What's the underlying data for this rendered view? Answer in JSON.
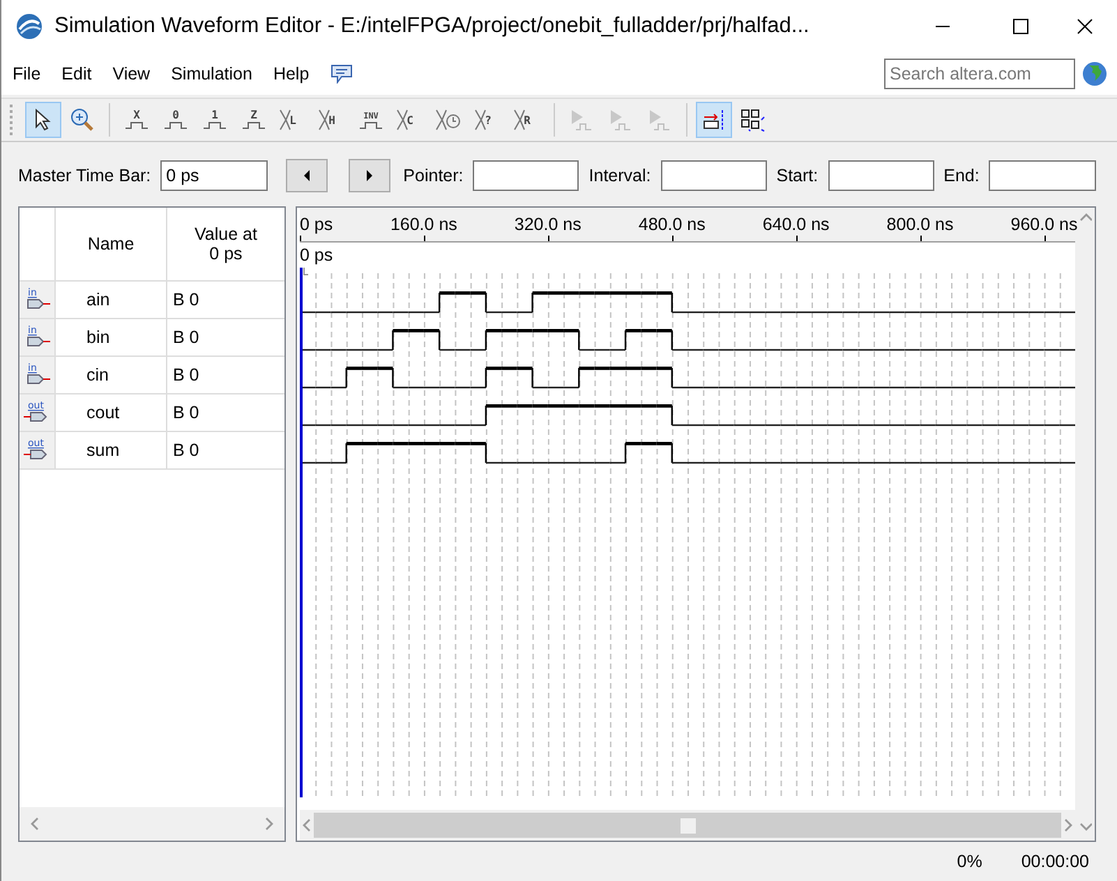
{
  "window": {
    "title": "Simulation Waveform Editor - E:/intelFPGA/project/onebit_fulladder/prj/halfad..."
  },
  "menu": [
    "File",
    "Edit",
    "View",
    "Simulation",
    "Help"
  ],
  "search": {
    "placeholder": "Search altera.com"
  },
  "toolbar": [
    {
      "kind": "pointer",
      "selected": true,
      "disabled": false
    },
    {
      "kind": "zoom",
      "selected": false,
      "disabled": false
    },
    {
      "kind": "separator"
    },
    {
      "kind": "level",
      "glyph": "X",
      "selected": false,
      "disabled": false
    },
    {
      "kind": "level",
      "glyph": "0",
      "selected": false,
      "disabled": false
    },
    {
      "kind": "level",
      "glyph": "1",
      "selected": false,
      "disabled": false
    },
    {
      "kind": "level",
      "glyph": "Z",
      "selected": false,
      "disabled": false
    },
    {
      "kind": "bus",
      "glyph": "L",
      "selected": false,
      "disabled": false
    },
    {
      "kind": "bus",
      "glyph": "H",
      "selected": false,
      "disabled": false
    },
    {
      "kind": "level",
      "glyph": "INV",
      "selected": false,
      "disabled": false
    },
    {
      "kind": "bus",
      "glyph": "C",
      "selected": false,
      "disabled": false
    },
    {
      "kind": "clock",
      "selected": false,
      "disabled": false
    },
    {
      "kind": "bus",
      "glyph": "?",
      "selected": false,
      "disabled": false
    },
    {
      "kind": "bus",
      "glyph": "R",
      "selected": false,
      "disabled": false
    },
    {
      "kind": "separator"
    },
    {
      "kind": "run",
      "selected": false,
      "disabled": true
    },
    {
      "kind": "run",
      "selected": false,
      "disabled": true
    },
    {
      "kind": "run",
      "selected": false,
      "disabled": true
    },
    {
      "kind": "separator"
    },
    {
      "kind": "snap",
      "selected": true,
      "disabled": false
    },
    {
      "kind": "grid",
      "selected": false,
      "disabled": false
    }
  ],
  "time_bar": {
    "master_label": "Master Time Bar:",
    "master_value": "0 ps",
    "pointer_label": "Pointer:",
    "interval_label": "Interval:",
    "start_label": "Start:",
    "end_label": "End:"
  },
  "table": {
    "columns": [
      "Name",
      "Value at\n0 ps"
    ],
    "rows": [
      {
        "direction": "in",
        "name": "ain",
        "value": "B 0",
        "steps": [
          {
            "high": false
          },
          {
            "high": false
          },
          {
            "high": false
          },
          {
            "high": false
          },
          {
            "high": false
          },
          {
            "high": false
          },
          {
            "high": false
          },
          {
            "high": false
          },
          {
            "high": false
          },
          {
            "high": true
          },
          {
            "high": true
          },
          {
            "high": true
          },
          {
            "high": false
          },
          {
            "high": false
          },
          {
            "high": false
          },
          {
            "high": true
          },
          {
            "high": true
          },
          {
            "high": true
          },
          {
            "high": true
          },
          {
            "high": true
          },
          {
            "high": true
          },
          {
            "high": true
          },
          {
            "high": true
          },
          {
            "high": true
          },
          {
            "high": false
          },
          {
            "high": false
          },
          {
            "high": false
          },
          {
            "high": false
          },
          {
            "high": false
          },
          {
            "high": false
          },
          {
            "high": false
          },
          {
            "high": false
          },
          {
            "high": false
          },
          {
            "high": false
          },
          {
            "high": false
          },
          {
            "high": false
          },
          {
            "high": false
          },
          {
            "high": false
          },
          {
            "high": false
          },
          {
            "high": false
          },
          {
            "high": false
          },
          {
            "high": false
          },
          {
            "high": false
          },
          {
            "high": false
          },
          {
            "high": false
          },
          {
            "high": false
          },
          {
            "high": false
          },
          {
            "high": false
          },
          {
            "high": false
          },
          {
            "high": false
          }
        ]
      },
      {
        "direction": "in",
        "name": "bin",
        "value": "B 0",
        "steps": [
          {
            "high": false
          },
          {
            "high": false
          },
          {
            "high": false
          },
          {
            "high": false
          },
          {
            "high": false
          },
          {
            "high": false
          },
          {
            "high": true
          },
          {
            "high": true
          },
          {
            "high": true
          },
          {
            "high": false
          },
          {
            "high": false
          },
          {
            "high": false
          },
          {
            "high": true
          },
          {
            "high": true
          },
          {
            "high": true
          },
          {
            "high": true
          },
          {
            "high": true
          },
          {
            "high": true
          },
          {
            "high": false
          },
          {
            "high": false
          },
          {
            "high": false
          },
          {
            "high": true
          },
          {
            "high": true
          },
          {
            "high": true
          },
          {
            "high": false
          },
          {
            "high": false
          },
          {
            "high": false
          },
          {
            "high": false
          },
          {
            "high": false
          },
          {
            "high": false
          },
          {
            "high": false
          },
          {
            "high": false
          },
          {
            "high": false
          },
          {
            "high": false
          },
          {
            "high": false
          },
          {
            "high": false
          },
          {
            "high": false
          },
          {
            "high": false
          },
          {
            "high": false
          },
          {
            "high": false
          },
          {
            "high": false
          },
          {
            "high": false
          },
          {
            "high": false
          },
          {
            "high": false
          },
          {
            "high": false
          },
          {
            "high": false
          },
          {
            "high": false
          },
          {
            "high": false
          },
          {
            "high": false
          },
          {
            "high": false
          }
        ]
      },
      {
        "direction": "in",
        "name": "cin",
        "value": "B 0",
        "steps": [
          {
            "high": false
          },
          {
            "high": false
          },
          {
            "high": false
          },
          {
            "high": true
          },
          {
            "high": true
          },
          {
            "high": true
          },
          {
            "high": false
          },
          {
            "high": false
          },
          {
            "high": false
          },
          {
            "high": false
          },
          {
            "high": false
          },
          {
            "high": false
          },
          {
            "high": true
          },
          {
            "high": true
          },
          {
            "high": true
          },
          {
            "high": false
          },
          {
            "high": false
          },
          {
            "high": false
          },
          {
            "high": true
          },
          {
            "high": true
          },
          {
            "high": true
          },
          {
            "high": true
          },
          {
            "high": true
          },
          {
            "high": true
          },
          {
            "high": false
          },
          {
            "high": false
          },
          {
            "high": false
          },
          {
            "high": false
          },
          {
            "high": false
          },
          {
            "high": false
          },
          {
            "high": false
          },
          {
            "high": false
          },
          {
            "high": false
          },
          {
            "high": false
          },
          {
            "high": false
          },
          {
            "high": false
          },
          {
            "high": false
          },
          {
            "high": false
          },
          {
            "high": false
          },
          {
            "high": false
          },
          {
            "high": false
          },
          {
            "high": false
          },
          {
            "high": false
          },
          {
            "high": false
          },
          {
            "high": false
          },
          {
            "high": false
          },
          {
            "high": false
          },
          {
            "high": false
          },
          {
            "high": false
          },
          {
            "high": false
          }
        ]
      },
      {
        "direction": "out",
        "name": "cout",
        "value": "B 0",
        "steps": [
          {
            "high": false
          },
          {
            "high": false
          },
          {
            "high": false
          },
          {
            "high": false
          },
          {
            "high": false
          },
          {
            "high": false
          },
          {
            "high": false
          },
          {
            "high": false
          },
          {
            "high": false
          },
          {
            "high": false
          },
          {
            "high": false
          },
          {
            "high": false
          },
          {
            "high": true
          },
          {
            "high": true
          },
          {
            "high": true
          },
          {
            "high": true
          },
          {
            "high": true
          },
          {
            "high": true
          },
          {
            "high": true
          },
          {
            "high": true
          },
          {
            "high": true
          },
          {
            "high": true
          },
          {
            "high": true
          },
          {
            "high": true
          },
          {
            "high": false
          },
          {
            "high": false
          },
          {
            "high": false
          },
          {
            "high": false
          },
          {
            "high": false
          },
          {
            "high": false
          },
          {
            "high": false
          },
          {
            "high": false
          },
          {
            "high": false
          },
          {
            "high": false
          },
          {
            "high": false
          },
          {
            "high": false
          },
          {
            "high": false
          },
          {
            "high": false
          },
          {
            "high": false
          },
          {
            "high": false
          },
          {
            "high": false
          },
          {
            "high": false
          },
          {
            "high": false
          },
          {
            "high": false
          },
          {
            "high": false
          },
          {
            "high": false
          },
          {
            "high": false
          },
          {
            "high": false
          },
          {
            "high": false
          },
          {
            "high": false
          }
        ]
      },
      {
        "direction": "out",
        "name": "sum",
        "value": "B 0",
        "steps": [
          {
            "high": false
          },
          {
            "high": false
          },
          {
            "high": false
          },
          {
            "high": true
          },
          {
            "high": true
          },
          {
            "high": true
          },
          {
            "high": true
          },
          {
            "high": true
          },
          {
            "high": true
          },
          {
            "high": true
          },
          {
            "high": true
          },
          {
            "high": true
          },
          {
            "high": false
          },
          {
            "high": false
          },
          {
            "high": false
          },
          {
            "high": false
          },
          {
            "high": false
          },
          {
            "high": false
          },
          {
            "high": false
          },
          {
            "high": false
          },
          {
            "high": false
          },
          {
            "high": true
          },
          {
            "high": true
          },
          {
            "high": true
          },
          {
            "high": false
          },
          {
            "high": false
          },
          {
            "high": false
          },
          {
            "high": false
          },
          {
            "high": false
          },
          {
            "high": false
          },
          {
            "high": false
          },
          {
            "high": false
          },
          {
            "high": false
          },
          {
            "high": false
          },
          {
            "high": false
          },
          {
            "high": false
          },
          {
            "high": false
          },
          {
            "high": false
          },
          {
            "high": false
          },
          {
            "high": false
          },
          {
            "high": false
          },
          {
            "high": false
          },
          {
            "high": false
          },
          {
            "high": false
          },
          {
            "high": false
          },
          {
            "high": false
          },
          {
            "high": false
          },
          {
            "high": false
          },
          {
            "high": false
          },
          {
            "high": false
          }
        ]
      }
    ]
  },
  "waveform": {
    "labels": [
      "0 ps",
      "160.0 ns",
      "320.0 ns",
      "480.0 ns",
      "640.0 ns",
      "800.0 ns",
      "960.0 ns"
    ],
    "cursor_label": "0 ps"
  },
  "status_bar": {
    "progress": "0%",
    "elapsed": "00:00:00"
  }
}
